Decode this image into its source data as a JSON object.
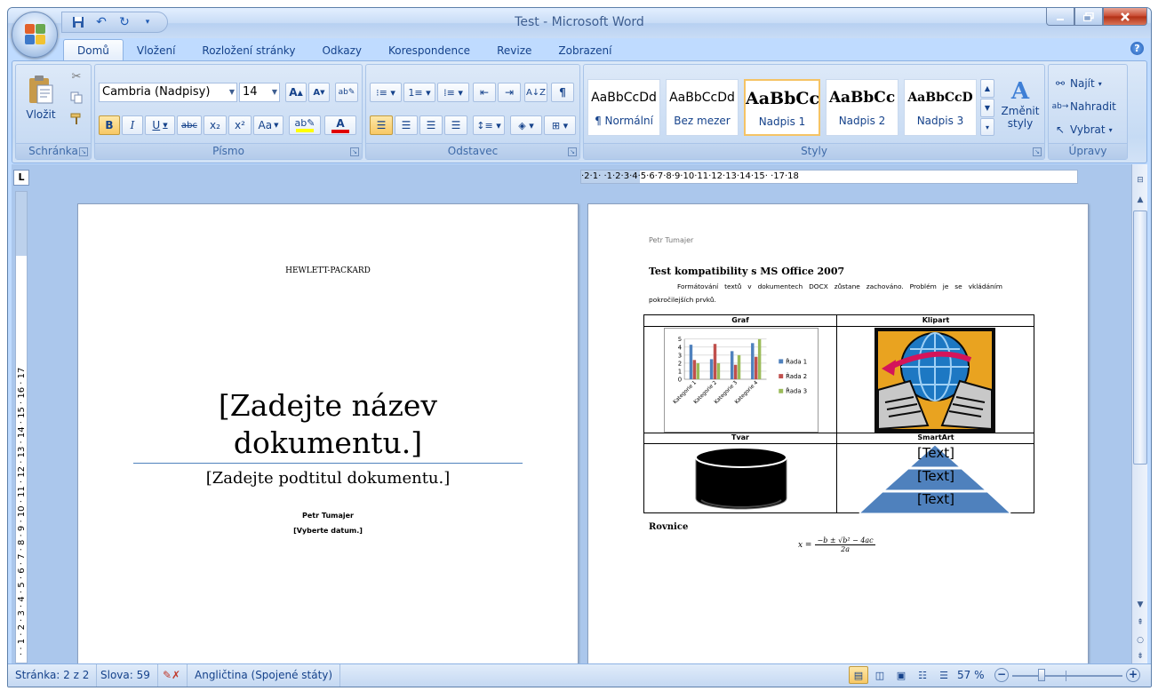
{
  "window": {
    "title": "Test - Microsoft Word"
  },
  "tabs": [
    "Domů",
    "Vložení",
    "Rozložení stránky",
    "Odkazy",
    "Korespondence",
    "Revize",
    "Zobrazení"
  ],
  "ribbon": {
    "clipboard": {
      "label": "Schránka",
      "paste_label": "Vložit"
    },
    "font": {
      "label": "Písmo",
      "font_name": "Cambria (Nadpisy)",
      "font_size": "14",
      "bold": "B",
      "italic": "I",
      "underline": "U",
      "strike": "abc",
      "subscript": "x₂",
      "superscript": "x²",
      "change_case": "Aa",
      "grow": "A",
      "shrink": "A"
    },
    "paragraph": {
      "label": "Odstavec"
    },
    "styles": {
      "label": "Styly",
      "items": [
        {
          "sample": "AaBbCcDd",
          "name": "¶ Normální"
        },
        {
          "sample": "AaBbCcDd",
          "name": "Bez mezer"
        },
        {
          "sample": "AaBbCc",
          "name": "Nadpis 1"
        },
        {
          "sample": "AaBbCc",
          "name": "Nadpis 2"
        },
        {
          "sample": "AaBbCcD",
          "name": "Nadpis 3"
        }
      ],
      "change_styles_line1": "Změnit",
      "change_styles_line2": "styly"
    },
    "editing": {
      "label": "Úpravy",
      "find": "Najít",
      "replace": "Nahradit",
      "select": "Vybrat"
    }
  },
  "ruler": {
    "horizontal": "·2·1· ·1·2·3·4·5·6·7·8·9·10·11·12·13·14·15· ·17·18",
    "vertical": "· · 1 · 2 · 3 · 4 · 5 · 6 · 7 · 8 · 9 · 10 · 11 · 12 · 13 · 14 · 15 · 16 · 17"
  },
  "page1": {
    "company": "HEWLETT-PACKARD",
    "title": "[Zadejte název dokumentu.]",
    "subtitle": "[Zadejte podtitul dokumentu.]",
    "author": "Petr Tumajer",
    "date": "[Vyberte datum.]"
  },
  "page2": {
    "header": "Petr Tumajer",
    "heading": "Test kompatibility s MS Office 2007",
    "paragraph": "Formátování textů v dokumentech DOCX zůstane zachováno. Problém je se vkládáním pokročilejších prvků.",
    "table": {
      "h_chart": "Graf",
      "h_clipart": "Klipart",
      "h_shape": "Tvar",
      "h_smartart": "SmartArt"
    },
    "smartart": [
      "[Text]",
      "[Text]",
      "[Text]"
    ],
    "equation_heading": "Rovnice",
    "equation_lhs": "x =",
    "equation_num": "−b ± √b² − 4ac",
    "equation_den": "2a"
  },
  "chart_data": {
    "type": "bar",
    "categories": [
      "Kategorie 1",
      "Kategorie 2",
      "Kategorie 3",
      "Kategorie 4"
    ],
    "series": [
      {
        "name": "Řada 1",
        "values": [
          4.3,
          2.5,
          3.5,
          4.5
        ],
        "color": "#4f81bd"
      },
      {
        "name": "Řada 2",
        "values": [
          2.4,
          4.4,
          1.8,
          2.8
        ],
        "color": "#c0504d"
      },
      {
        "name": "Řada 3",
        "values": [
          2,
          2,
          3,
          5
        ],
        "color": "#9bbb59"
      }
    ],
    "yticks": [
      "0",
      "1",
      "2",
      "3",
      "4",
      "5"
    ],
    "ylim": [
      0,
      5
    ],
    "grid": true,
    "legend": "right"
  },
  "statusbar": {
    "page": "Stránka: 2 z 2",
    "words": "Slova: 59",
    "language": "Angličtina (Spojené státy)",
    "zoom": "57 %"
  },
  "colors": {
    "accent": "#15428b",
    "ribbon": "#c6dbf4",
    "doc_background": "#abc7ec",
    "smartart": "#4f81bd"
  }
}
